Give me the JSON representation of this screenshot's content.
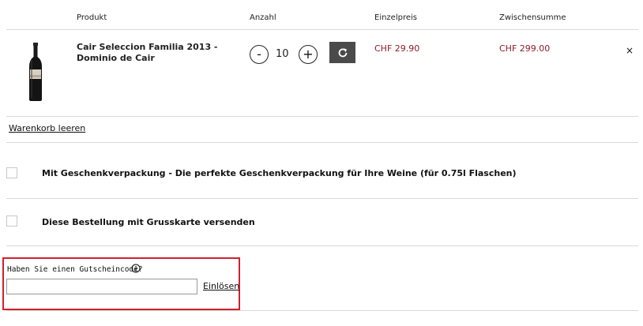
{
  "table_header": {
    "product": "Produkt",
    "quantity": "Anzahl",
    "unit_price": "Einzelpreis",
    "subtotal": "Zwischensumme"
  },
  "cart_item": {
    "name": "Cair Seleccion Familia 2013 - Dominio de Cair",
    "quantity": "10",
    "minus_label": "-",
    "plus_label": "+",
    "unit_price": "CHF 29.90",
    "subtotal": "CHF 299.00",
    "remove_label": "×",
    "price_color": "#8a1c2b"
  },
  "empty_cart_label": "Warenkorb leeren",
  "options": [
    {
      "label": "Mit Geschenkverpackung - Die perfekte Geschenkverpackung für Ihre Weine (für 0.75l Flaschen)",
      "checked": false
    },
    {
      "label": "Diese Bestellung mit Grusskarte versenden",
      "checked": false
    }
  ],
  "coupon": {
    "label": "Haben Sie einen Gutscheincode?",
    "value": "",
    "placeholder": "",
    "redeem_label": "Einlösen",
    "highlight_color": "#d0202e"
  }
}
